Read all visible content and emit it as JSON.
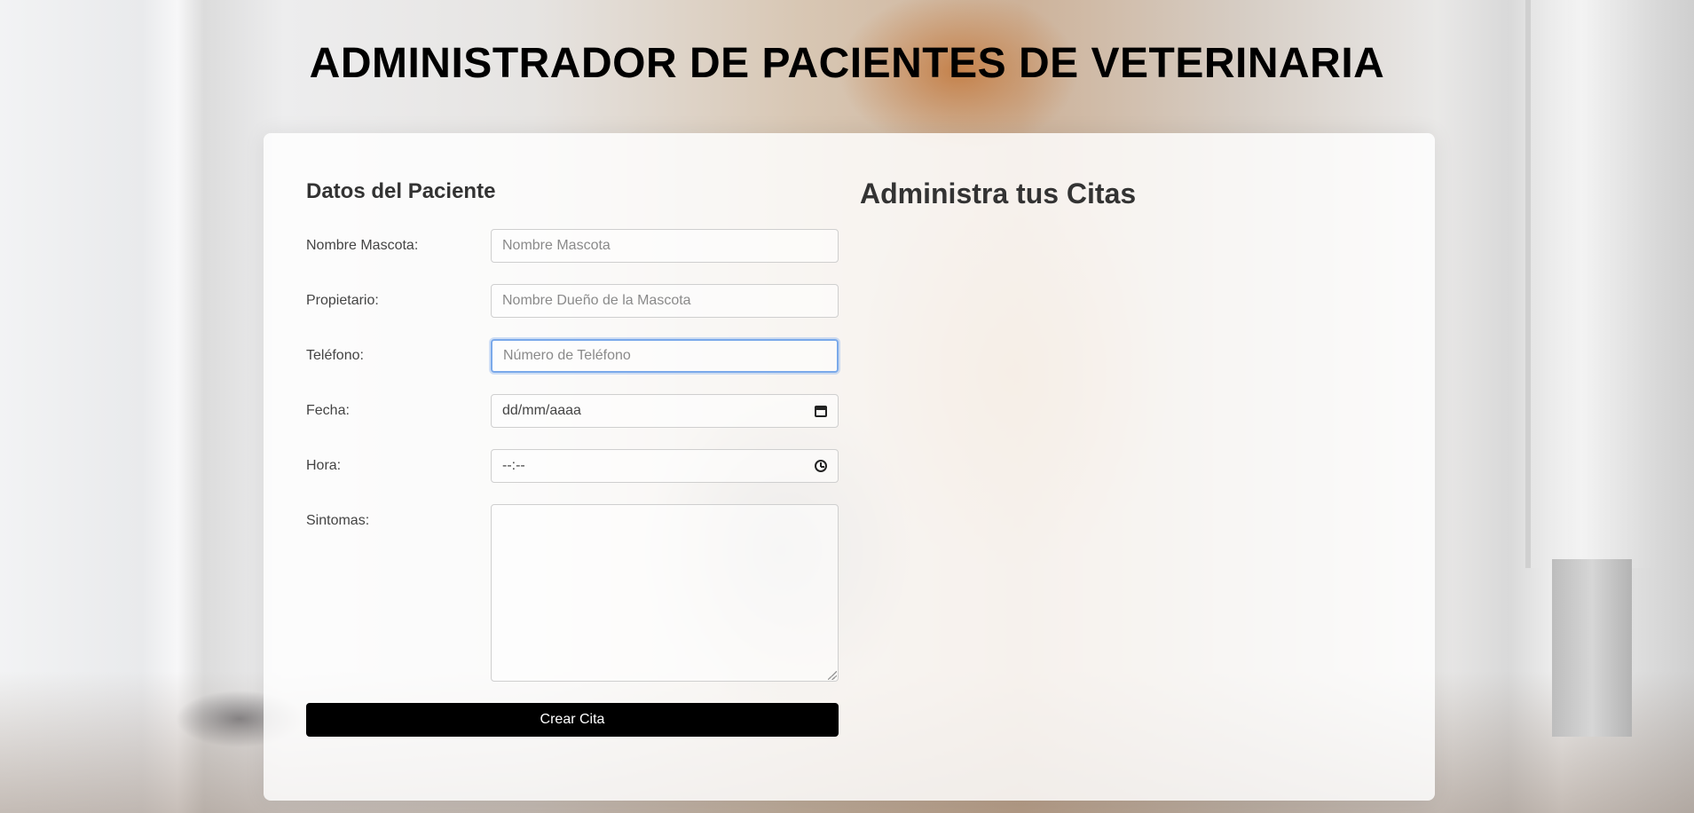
{
  "header": {
    "title": "ADMINISTRADOR DE PACIENTES DE VETERINARIA"
  },
  "form": {
    "title": "Datos del Paciente",
    "fields": {
      "mascota": {
        "label": "Nombre Mascota:",
        "placeholder": "Nombre Mascota"
      },
      "propietario": {
        "label": "Propietario:",
        "placeholder": "Nombre Dueño de la Mascota"
      },
      "telefono": {
        "label": "Teléfono:",
        "placeholder": "Número de Teléfono"
      },
      "fecha": {
        "label": "Fecha:",
        "value": "dd/mm/aaaa"
      },
      "hora": {
        "label": "Hora:",
        "value": "--:--"
      },
      "sintomas": {
        "label": "Sintomas:"
      }
    },
    "submit_label": "Crear Cita"
  },
  "appointments": {
    "title": "Administra tus Citas"
  },
  "icons": {
    "date": "calendar-icon",
    "time": "clock-icon"
  },
  "colors": {
    "button_bg": "#000000",
    "focus_ring": "#7aa9ea"
  }
}
